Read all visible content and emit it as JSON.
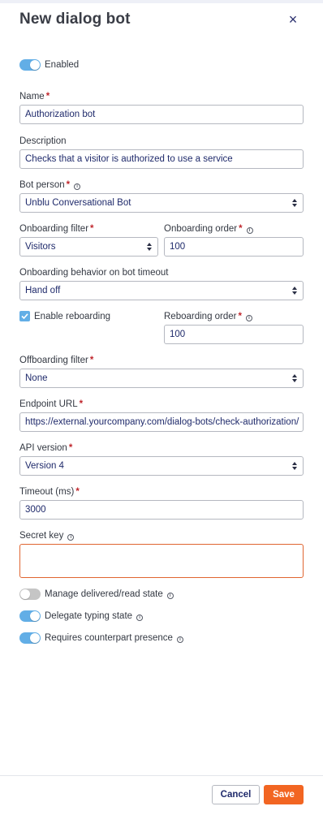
{
  "dialog": {
    "title": "New dialog bot",
    "close_icon": "×"
  },
  "enabled": {
    "label": "Enabled",
    "on": true
  },
  "name": {
    "label": "Name",
    "value": "Authorization bot"
  },
  "description": {
    "label": "Description",
    "value": "Checks that a visitor is authorized to use a service"
  },
  "bot_person": {
    "label": "Bot person",
    "value": "Unblu Conversational Bot"
  },
  "onboarding_filter": {
    "label": "Onboarding filter",
    "value": "Visitors"
  },
  "onboarding_order": {
    "label": "Onboarding order",
    "value": "100"
  },
  "onboarding_behavior": {
    "label": "Onboarding behavior on bot timeout",
    "value": "Hand off"
  },
  "enable_reboarding": {
    "label": "Enable reboarding",
    "checked": true
  },
  "reboarding_order": {
    "label": "Reboarding order",
    "value": "100"
  },
  "offboarding_filter": {
    "label": "Offboarding filter",
    "value": "None"
  },
  "endpoint_url": {
    "label": "Endpoint URL",
    "value": "https://external.yourcompany.com/dialog-bots/check-authorization/"
  },
  "api_version": {
    "label": "API version",
    "value": "Version 4"
  },
  "timeout": {
    "label": "Timeout (ms)",
    "value": "3000"
  },
  "secret_key": {
    "label": "Secret key",
    "value": ""
  },
  "toggles": {
    "manage_delivered": {
      "label": "Manage delivered/read state",
      "on": false
    },
    "delegate_typing": {
      "label": "Delegate typing state",
      "on": true
    },
    "requires_counterpart": {
      "label": "Requires counterpart presence",
      "on": true
    }
  },
  "common": {
    "required_mark": "*",
    "info_icon": "i"
  },
  "footer": {
    "cancel_label": "Cancel",
    "save_label": "Save"
  },
  "colors": {
    "accent": "#62aee6",
    "primary_button": "#f26522",
    "required": "#c0272d",
    "text_value": "#1f2a6b"
  }
}
